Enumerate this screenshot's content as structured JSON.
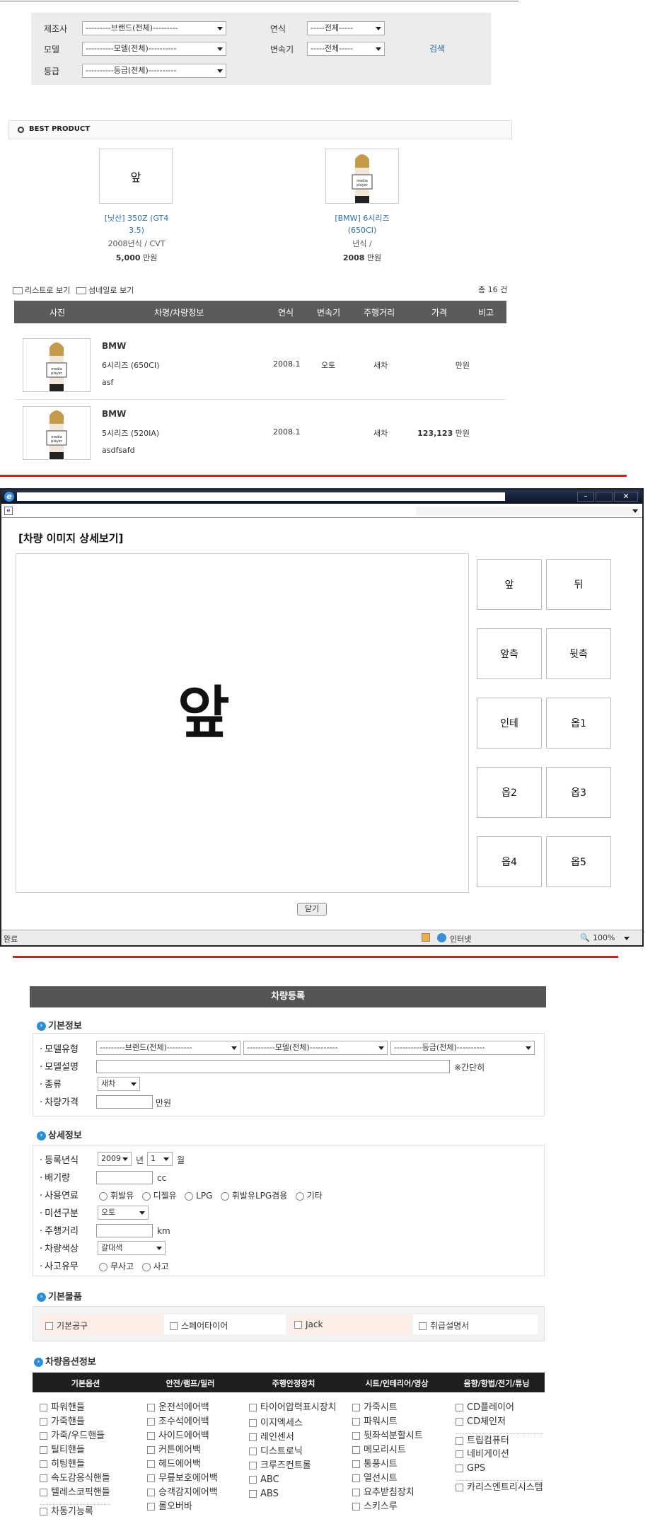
{
  "search": {
    "maker_label": "제조사",
    "model_label": "모델",
    "grade_label": "등급",
    "maker_select": "---------브랜드(전체)---------",
    "model_select": "----------모델(전체)----------",
    "grade_select": "----------등급(전체)----------",
    "year_label": "연식",
    "trans_label": "변속기",
    "year_select": "-----전체-----",
    "trans_select": "-----전체-----",
    "search_button": "검색"
  },
  "best": {
    "title": "BEST PRODUCT",
    "items": [
      {
        "thumb_text": "앞",
        "name": "[닛산] 350Z (GT4 3.5)",
        "spec": "2008년식 / CVT",
        "price_num": "5,000",
        "price_unit": "만원"
      },
      {
        "thumb_text": "",
        "name": "[BMW] 6시리즈 (650CI)",
        "spec": "년식 /",
        "price_num": "2008",
        "price_unit": "만원"
      }
    ]
  },
  "list": {
    "list_view": "리스트로 보기",
    "thumb_view": "섬네일로 보기",
    "total": "총 16 건",
    "headers": [
      "사진",
      "차명/차량정보",
      "연식",
      "변속기",
      "주행거리",
      "가격",
      "비고"
    ],
    "rows": [
      {
        "brand": "BMW",
        "model": "6시리즈 (650CI)",
        "note": "asf",
        "year": "2008.1",
        "trans": "오토",
        "mileage": "새차",
        "price": "",
        "price_unit": "만원"
      },
      {
        "brand": "BMW",
        "model": "5시리즈 (520IA)",
        "note": "asdfsafd",
        "year": "2008.1",
        "trans": "",
        "mileage": "새차",
        "price": "123,123",
        "price_unit": "만원"
      }
    ]
  },
  "popup": {
    "heading": "[차량 이미지 상세보기]",
    "main_text": "앞",
    "tiles": [
      "앞",
      "뒤",
      "앞측",
      "뒷측",
      "인테",
      "옵1",
      "옵2",
      "옵3",
      "옵4",
      "옵5"
    ],
    "close_button": "닫기",
    "status_left": "완료",
    "status_zone": "인터넷",
    "zoom": "100%"
  },
  "reg": {
    "title": "차량등록",
    "basic_title": "기본정보",
    "model_type_label": "모델유형",
    "model_desc_label": "모델설명",
    "kind_label": "종류",
    "price_label": "차량가격",
    "brand_select": "---------브랜드(전체)---------",
    "model_select": "----------모델(전체)----------",
    "grade_select": "----------등급(전체)----------",
    "desc_hint": "※간단히",
    "kind_value": "새차",
    "price_unit": "만원",
    "detail_title": "상세정보",
    "reg_year_label": "등록년식",
    "year_value": "2009",
    "year_unit": "년",
    "month_value": "1",
    "month_unit": "월",
    "displacement_label": "배기량",
    "cc_unit": "cc",
    "fuel_label": "사용연료",
    "fuels": [
      "휘발유",
      "디젤유",
      "LPG",
      "휘발유LPG겸용",
      "기타"
    ],
    "mission_label": "미션구분",
    "mission_value": "오토",
    "mileage_label": "주행거리",
    "km_unit": "km",
    "color_label": "차량색상",
    "color_value": "갈대색",
    "accident_label": "사고유무",
    "accident_options": [
      "무사고",
      "사고"
    ],
    "goods_title": "기본물품",
    "goods": [
      "기본공구",
      "스페어타이어",
      "Jack",
      "취급설명서"
    ],
    "options_title": "차량옵션정보",
    "option_headers": [
      "기본옵션",
      "안전/램프/밀러",
      "주행안정장치",
      "시트/인테리어/영상",
      "음향/항법/전기/튜닝"
    ],
    "col1": [
      "파워핸들",
      "가죽핸들",
      "가죽/우드핸들",
      "틸티핸들",
      "히팅핸들",
      "속도감응식핸들",
      "텔레스코픽핸들"
    ],
    "col2": [
      "운전석에어백",
      "조수석에어백",
      "사이드에어백",
      "커튼에어백",
      "헤드에어백",
      "무릎보호에어백",
      "승객감지에어백",
      "롤오버바"
    ],
    "col3": [
      "타이어압력표시장치",
      "이지엑세스",
      "레인센서",
      "디스트로닉",
      "크루즈컨트롤",
      "ABC",
      "ABS"
    ],
    "col4": [
      "가죽시트",
      "파워시트",
      "뒷좌석분할시트",
      "메모리시트",
      "통풍시트",
      "열선시트",
      "요추받침장치",
      "스키스루"
    ],
    "col5": [
      "CD플레이어",
      "CD체인저",
      "트립컴퓨터",
      "네비게이션",
      "GPS",
      "카리스엔트리시스템"
    ],
    "col1_partial": "차동기능록"
  }
}
